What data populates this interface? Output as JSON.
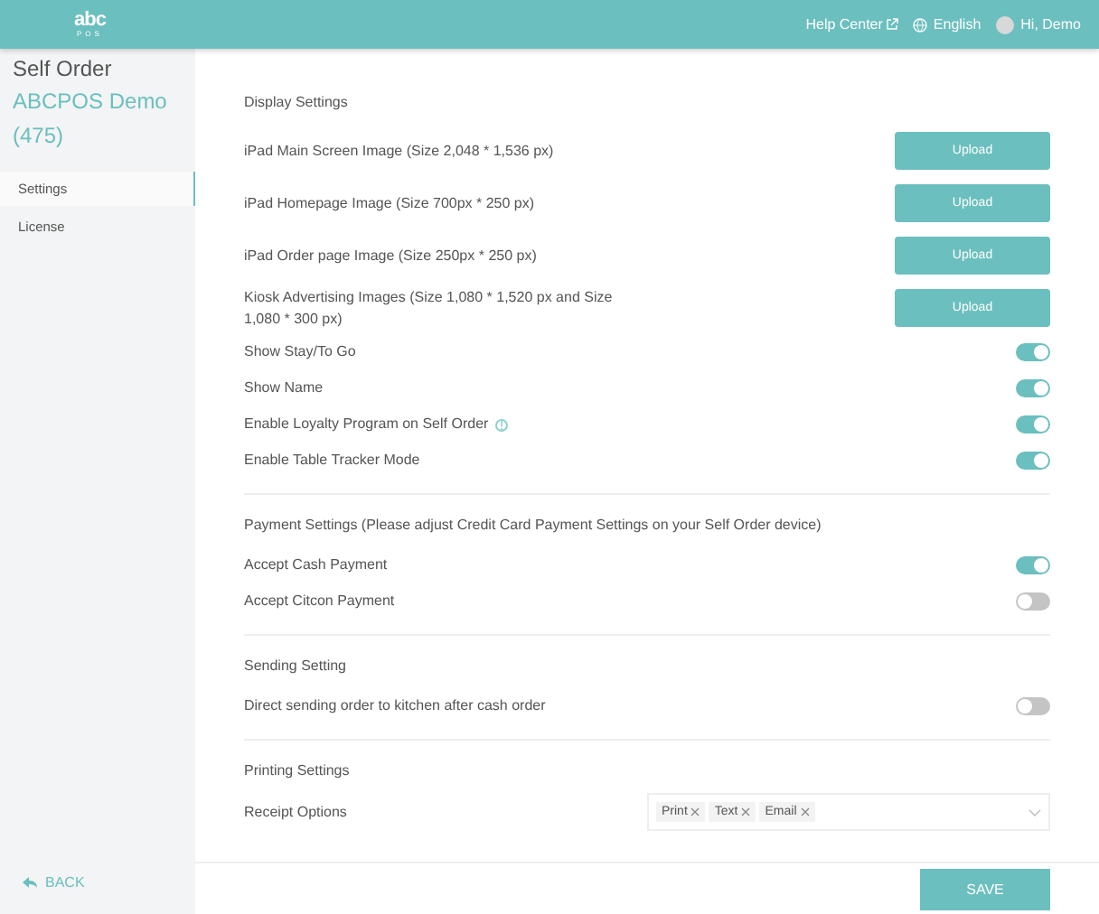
{
  "header": {
    "logo_top": "abc",
    "logo_bottom": "POS",
    "help": "Help Center",
    "language": "English",
    "greeting": "Hi, Demo"
  },
  "sidebar": {
    "title": "Self Order",
    "store": "ABCPOS Demo (475)",
    "items": [
      {
        "label": "Settings",
        "selected": true
      },
      {
        "label": "License",
        "selected": false
      }
    ],
    "back": "BACK"
  },
  "sections": [
    {
      "title": "Display Settings",
      "rows": [
        {
          "kind": "upload",
          "label": "iPad Main Screen Image (Size 2,048 * 1,536 px)",
          "button": "Upload"
        },
        {
          "kind": "upload",
          "label": "iPad Homepage Image (Size 700px * 250 px)",
          "button": "Upload"
        },
        {
          "kind": "upload",
          "label": "iPad Order page Image (Size 250px * 250 px)",
          "button": "Upload"
        },
        {
          "kind": "upload",
          "label": "Kiosk Advertising Images (Size 1,080 * 1,520 px and Size 1,080 * 300 px)",
          "button": "Upload"
        },
        {
          "kind": "toggle",
          "label": "Show Stay/To Go",
          "on": true
        },
        {
          "kind": "toggle",
          "label": "Show Name",
          "on": true
        },
        {
          "kind": "toggle",
          "label": "Enable Loyalty Program on Self Order",
          "on": true,
          "info": true
        },
        {
          "kind": "toggle",
          "label": "Enable Table Tracker Mode",
          "on": true
        }
      ]
    },
    {
      "title": "Payment Settings (Please adjust Credit Card Payment Settings on your Self Order device)",
      "rows": [
        {
          "kind": "toggle",
          "label": "Accept Cash Payment",
          "on": true
        },
        {
          "kind": "toggle",
          "label": "Accept Citcon Payment",
          "on": false
        }
      ]
    },
    {
      "title": "Sending Setting",
      "rows": [
        {
          "kind": "toggle",
          "label": "Direct sending order to kitchen after cash order",
          "on": false
        }
      ]
    },
    {
      "title": "Printing Settings",
      "rows": [
        {
          "kind": "tags",
          "label": "Receipt Options",
          "tags": [
            "Print",
            "Text",
            "Email"
          ]
        }
      ]
    }
  ],
  "save": "SAVE"
}
